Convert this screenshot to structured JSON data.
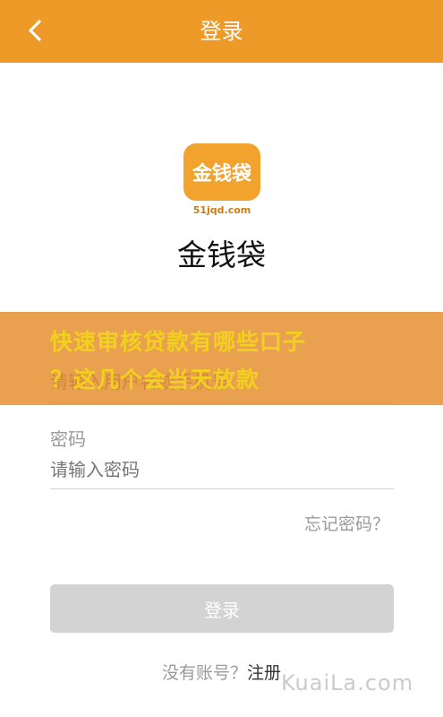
{
  "header": {
    "title": "登录",
    "back_icon": "chevron-left-icon",
    "background": "#ee9a29"
  },
  "logo": {
    "text": "金钱袋",
    "domain": "51jqd.com"
  },
  "app_name": "金钱袋",
  "overlay": {
    "line1": "快速审核贷款有哪些口子",
    "line2": "？这几个会当天放款"
  },
  "form": {
    "username_placeholder": "请输入用户名或手机号",
    "password_label": "密码",
    "password_placeholder": "请输入密码",
    "forgot_label": "忘记密码？"
  },
  "login_button": "登录",
  "footer": {
    "no_account": "没有账号？",
    "register": "注册"
  },
  "watermark": "KuaiLa.com"
}
